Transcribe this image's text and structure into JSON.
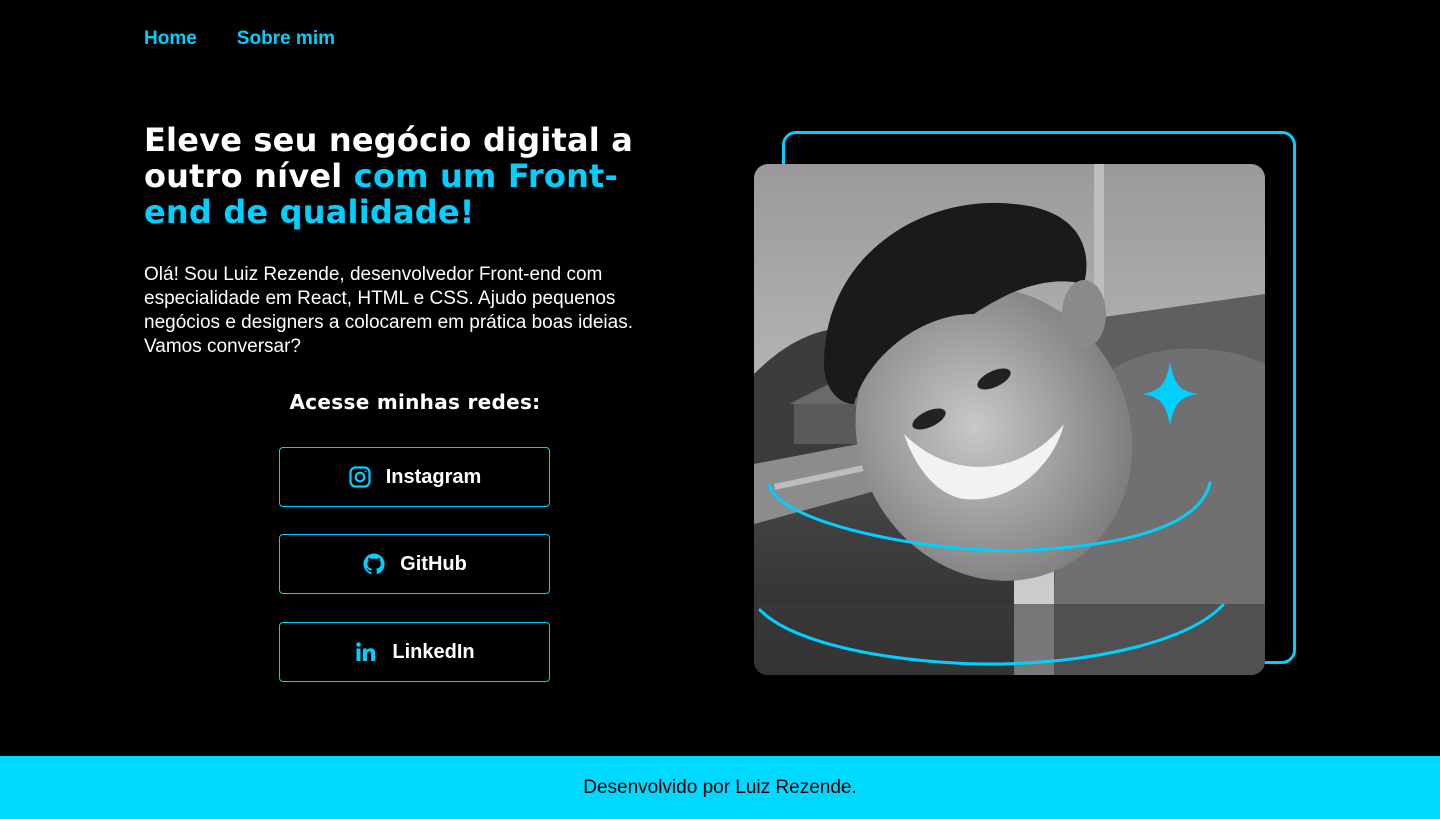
{
  "nav": {
    "items": [
      {
        "label": "Home"
      },
      {
        "label": "Sobre mim"
      }
    ]
  },
  "hero": {
    "headline_white": "Eleve seu negócio digital a outro nível ",
    "headline_accent": "com um Front-end de qualidade!",
    "intro": "Olá! Sou Luiz Rezende, desenvolvedor Front-end com especialidade em React, HTML e CSS. Ajudo pequenos negócios e designers a colocarem em prática boas ideias. Vamos conversar?"
  },
  "social": {
    "heading": "Acesse minhas redes:",
    "buttons": [
      {
        "label": "Instagram",
        "icon": "instagram-icon"
      },
      {
        "label": "GitHub",
        "icon": "github-icon"
      },
      {
        "label": "LinkedIn",
        "icon": "linkedin-icon"
      }
    ]
  },
  "footer": {
    "text": "Desenvolvido por Luiz Rezende."
  },
  "colors": {
    "accent": "#00d0ff",
    "footer_bg": "#00d9ff",
    "background": "#000000",
    "text": "#ffffff"
  }
}
